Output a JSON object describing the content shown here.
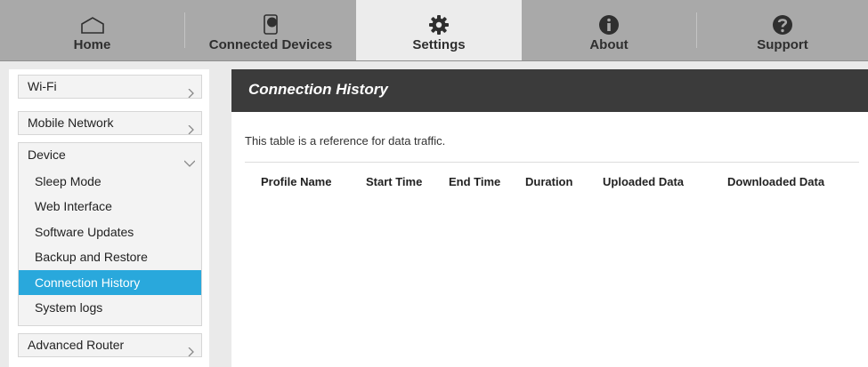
{
  "nav": {
    "tabs": [
      {
        "label": "Home",
        "icon": "home-icon",
        "active": false
      },
      {
        "label": "Connected Devices",
        "icon": "devices-icon",
        "active": false
      },
      {
        "label": "Settings",
        "icon": "gear-icon",
        "active": true
      },
      {
        "label": "About",
        "icon": "info-icon",
        "active": false
      },
      {
        "label": "Support",
        "icon": "question-icon",
        "active": false
      }
    ]
  },
  "sidebar": {
    "wifi": "Wi-Fi",
    "mobile_network": "Mobile Network",
    "device": {
      "label": "Device",
      "items": [
        "Sleep Mode",
        "Web Interface",
        "Software Updates",
        "Backup and Restore",
        "Connection History",
        "System logs"
      ],
      "active_item": "Connection History"
    },
    "advanced_router": "Advanced Router"
  },
  "main": {
    "title": "Connection History",
    "description": "This table is a reference for data traffic.",
    "columns": [
      "Profile Name",
      "Start Time",
      "End Time",
      "Duration",
      "Uploaded Data",
      "Downloaded Data"
    ],
    "rows": []
  },
  "colors": {
    "nav_bg": "#a9a9a9",
    "active_tab_bg": "#ececec",
    "header_bg": "#3b3b3b",
    "active_item_bg": "#29a8dc"
  }
}
